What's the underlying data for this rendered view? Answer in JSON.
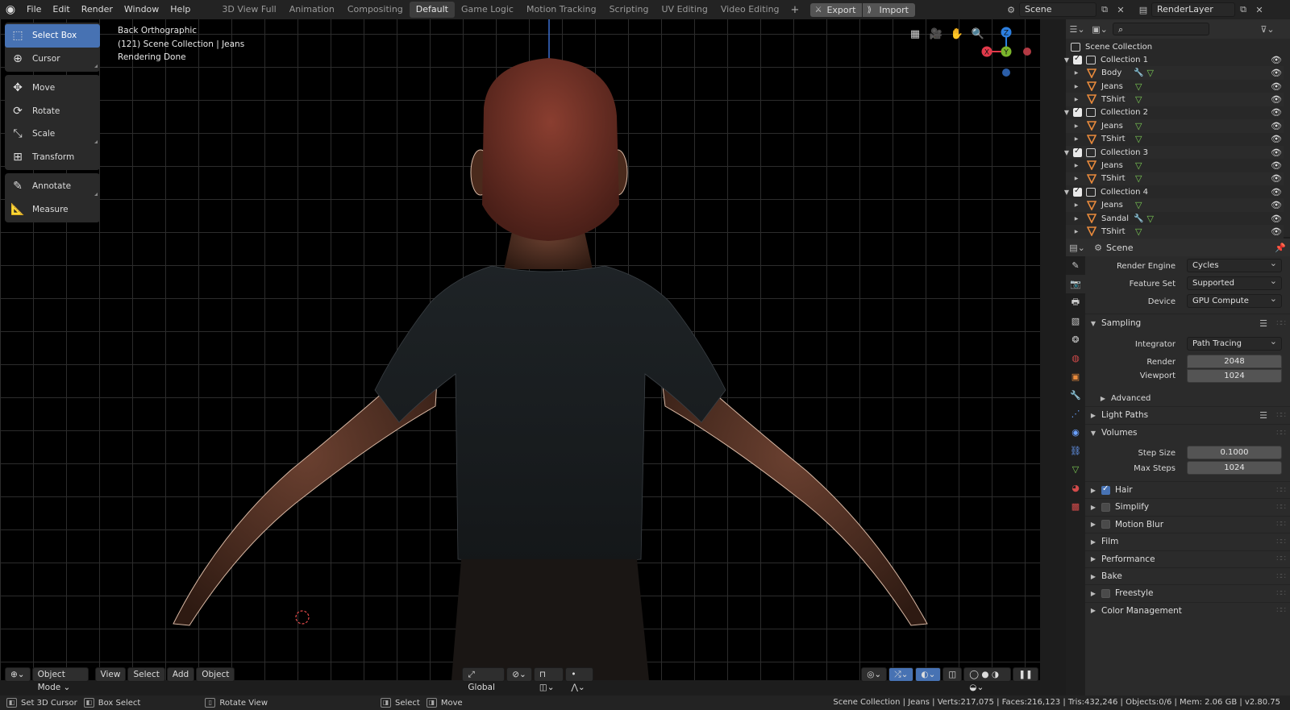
{
  "menu": [
    "File",
    "Edit",
    "Render",
    "Window",
    "Help"
  ],
  "workspaces": [
    {
      "label": "3D View Full",
      "active": false
    },
    {
      "label": "Animation",
      "active": false
    },
    {
      "label": "Compositing",
      "active": false
    },
    {
      "label": "Default",
      "active": true
    },
    {
      "label": "Game Logic",
      "active": false
    },
    {
      "label": "Motion Tracking",
      "active": false
    },
    {
      "label": "Scripting",
      "active": false
    },
    {
      "label": "UV Editing",
      "active": false
    },
    {
      "label": "Video Editing",
      "active": false
    }
  ],
  "io": {
    "export": "Export",
    "import": "Import"
  },
  "scene_name": "Scene",
  "render_layer": "RenderLayer",
  "viewport": {
    "view_name": "Back Orthographic",
    "collection_info": "(121) Scene Collection | Jeans",
    "status": "Rendering Done"
  },
  "tools": [
    [
      {
        "label": "Select Box",
        "icon": "select-box-icon",
        "active": true
      },
      {
        "label": "Cursor",
        "icon": "cursor-icon",
        "active": false
      }
    ],
    [
      {
        "label": "Move",
        "icon": "move-icon",
        "active": false
      },
      {
        "label": "Rotate",
        "icon": "rotate-icon",
        "active": false
      },
      {
        "label": "Scale",
        "icon": "scale-icon",
        "active": false
      },
      {
        "label": "Transform",
        "icon": "transform-icon",
        "active": false
      }
    ],
    [
      {
        "label": "Annotate",
        "icon": "annotate-icon",
        "active": false
      },
      {
        "label": "Measure",
        "icon": "measure-icon",
        "active": false
      }
    ]
  ],
  "gizmo": {
    "x": "X",
    "y": "Y",
    "z": "Z"
  },
  "viewport_header": {
    "mode": "Object Mode",
    "menus": [
      "View",
      "Select",
      "Add",
      "Object"
    ],
    "orientation": "Global"
  },
  "outliner": {
    "root": "Scene Collection",
    "rows": [
      {
        "type": "collection",
        "label": "Collection 1"
      },
      {
        "type": "object",
        "label": "Body",
        "modifier": true
      },
      {
        "type": "object",
        "label": "Jeans",
        "modifier": false
      },
      {
        "type": "object",
        "label": "TShirt",
        "modifier": false
      },
      {
        "type": "collection",
        "label": "Collection 2"
      },
      {
        "type": "object",
        "label": "Jeans",
        "modifier": false
      },
      {
        "type": "object",
        "label": "TShirt",
        "modifier": false
      },
      {
        "type": "collection",
        "label": "Collection 3"
      },
      {
        "type": "object",
        "label": "Jeans",
        "modifier": false
      },
      {
        "type": "object",
        "label": "TShirt",
        "modifier": false
      },
      {
        "type": "collection",
        "label": "Collection 4"
      },
      {
        "type": "object",
        "label": "Jeans",
        "modifier": false
      },
      {
        "type": "object",
        "label": "Sandal",
        "modifier": true
      },
      {
        "type": "object",
        "label": "TShirt",
        "modifier": false
      }
    ]
  },
  "properties": {
    "context": "Scene",
    "render_engine": {
      "label": "Render Engine",
      "value": "Cycles"
    },
    "feature_set": {
      "label": "Feature Set",
      "value": "Supported"
    },
    "device": {
      "label": "Device",
      "value": "GPU Compute"
    },
    "sampling": {
      "title": "Sampling",
      "integrator": {
        "label": "Integrator",
        "value": "Path Tracing"
      },
      "render": {
        "label": "Render",
        "value": "2048"
      },
      "viewport": {
        "label": "Viewport",
        "value": "1024"
      },
      "advanced": "Advanced"
    },
    "light_paths": "Light Paths",
    "volumes": {
      "title": "Volumes",
      "step_size": {
        "label": "Step Size",
        "value": "0.1000"
      },
      "max_steps": {
        "label": "Max Steps",
        "value": "1024"
      }
    },
    "panels": [
      {
        "label": "Hair",
        "checkbox": "on"
      },
      {
        "label": "Simplify",
        "checkbox": "off"
      },
      {
        "label": "Motion Blur",
        "checkbox": "off"
      },
      {
        "label": "Film",
        "checkbox": "none"
      },
      {
        "label": "Performance",
        "checkbox": "none"
      },
      {
        "label": "Bake",
        "checkbox": "none"
      },
      {
        "label": "Freestyle",
        "checkbox": "off"
      },
      {
        "label": "Color Management",
        "checkbox": "none"
      }
    ]
  },
  "statusbar": {
    "set_cursor": "Set 3D Cursor",
    "box_select": "Box Select",
    "rotate_view": "Rotate View",
    "select": "Select",
    "move": "Move",
    "stats": "Scene Collection | Jeans | Verts:217,075 | Faces:216,123 | Tris:432,246 | Objects:0/6 | Mem: 2.06 GB | v2.80.75"
  },
  "colors": {
    "accent": "#4772b3",
    "gizmo_x": "#e2394a",
    "gizmo_y": "#7ab52b",
    "gizmo_z": "#2c7fe0",
    "mesh_orange": "#e88a3c"
  }
}
